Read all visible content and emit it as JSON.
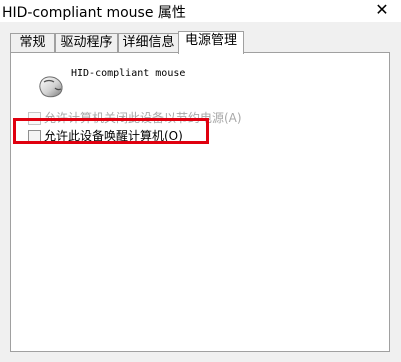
{
  "window": {
    "title": "HID-compliant mouse 属性",
    "close_glyph": "✕"
  },
  "tabs": [
    {
      "label": "常规",
      "active": false
    },
    {
      "label": "驱动程序",
      "active": false
    },
    {
      "label": "详细信息",
      "active": false
    },
    {
      "label": "电源管理",
      "active": true
    }
  ],
  "device": {
    "name": "HID-compliant mouse",
    "icon": "mouse-icon"
  },
  "options": [
    {
      "label": "允许计算机关闭此设备以节约电源(A)",
      "checked": false,
      "disabled": true
    },
    {
      "label": "允许此设备唤醒计算机(O)",
      "checked": false,
      "disabled": false
    }
  ],
  "colors": {
    "highlight": "#e0000f",
    "disabled_text": "#a8a8a8"
  }
}
